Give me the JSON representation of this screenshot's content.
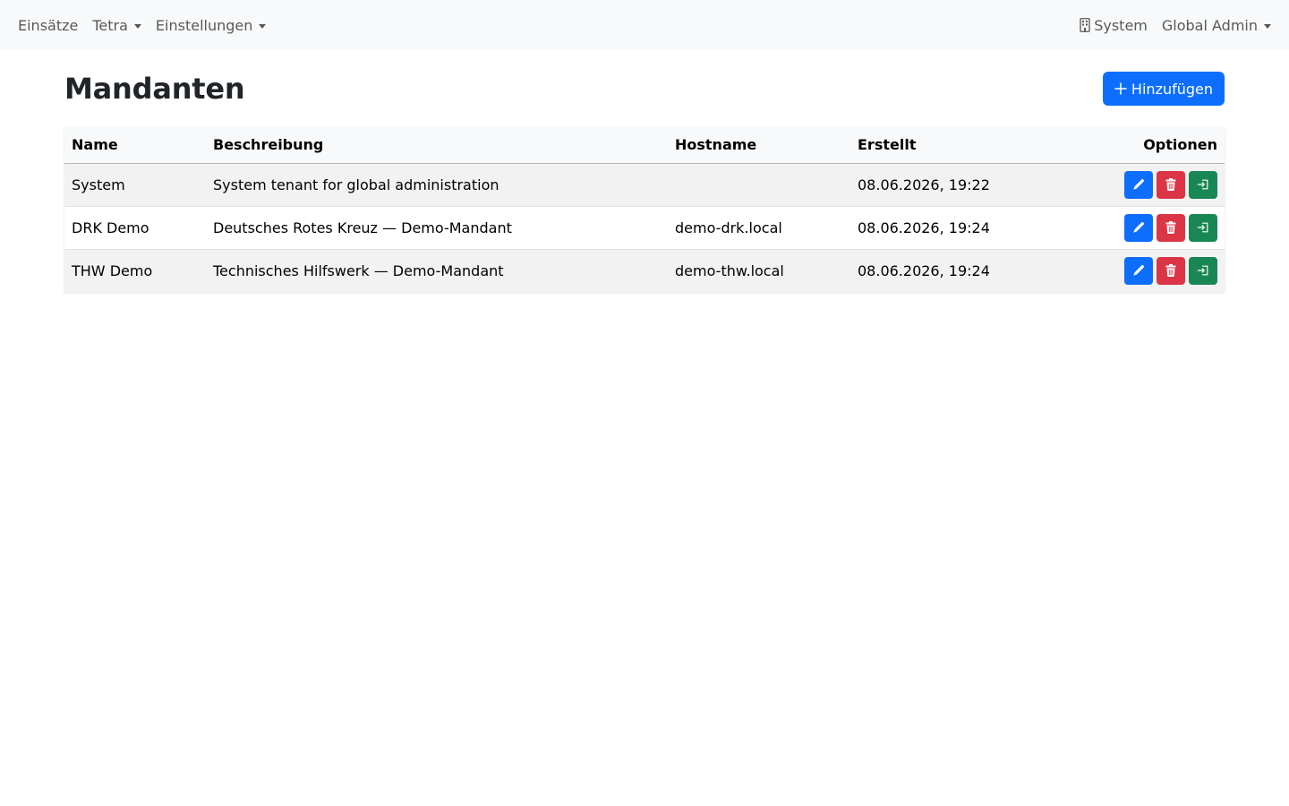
{
  "navbar": {
    "left_items": [
      {
        "label": "Einsätze",
        "dropdown": false
      },
      {
        "label": "Tetra",
        "dropdown": true
      },
      {
        "label": "Einstellungen",
        "dropdown": true
      }
    ],
    "tenant": {
      "label": "System",
      "icon": "building-icon"
    },
    "user": {
      "label": "Global Admin",
      "dropdown": true
    }
  },
  "page": {
    "title": "Mandanten",
    "add_button": {
      "label": "Hinzufügen",
      "icon": "plus-icon",
      "color": "#0d6efd"
    }
  },
  "table": {
    "columns": [
      "Name",
      "Beschreibung",
      "Hostname",
      "Erstellt",
      "Optionen"
    ],
    "rows": [
      {
        "name": "System",
        "description": "System tenant for global administration",
        "hostname": "",
        "created": "08.06.2026, 19:22"
      },
      {
        "name": "DRK Demo",
        "description": "Deutsches Rotes Kreuz — Demo-Mandant",
        "hostname": "demo-drk.local",
        "created": "08.06.2026, 19:24"
      },
      {
        "name": "THW Demo",
        "description": "Technisches Hilfswerk — Demo-Mandant",
        "hostname": "demo-thw.local",
        "created": "08.06.2026, 19:24"
      }
    ],
    "row_actions": [
      {
        "name": "edit",
        "icon": "pencil-icon",
        "color": "#0d6efd"
      },
      {
        "name": "delete",
        "icon": "trash-icon",
        "color": "#dc3545"
      },
      {
        "name": "switch-tenant",
        "icon": "login-icon",
        "color": "#198754"
      }
    ]
  }
}
